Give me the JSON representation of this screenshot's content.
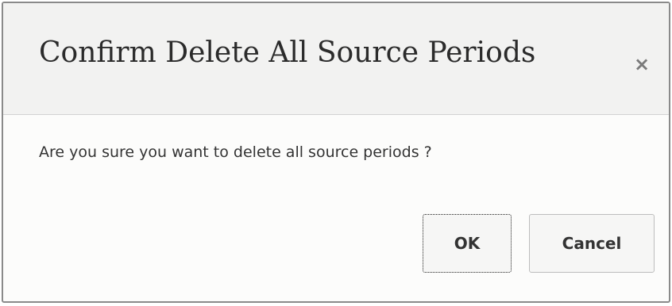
{
  "dialog": {
    "title": "Confirm Delete All Source Periods",
    "close_symbol": "×",
    "close_icon": "close-icon",
    "message": "Are you sure you want to delete all source periods ?",
    "buttons": {
      "ok_label": "OK",
      "cancel_label": "Cancel"
    }
  },
  "colors": {
    "header_background": "#f2f2f1",
    "body_background": "#fcfcfb",
    "border": "#8a8a8a",
    "text": "#333333"
  }
}
